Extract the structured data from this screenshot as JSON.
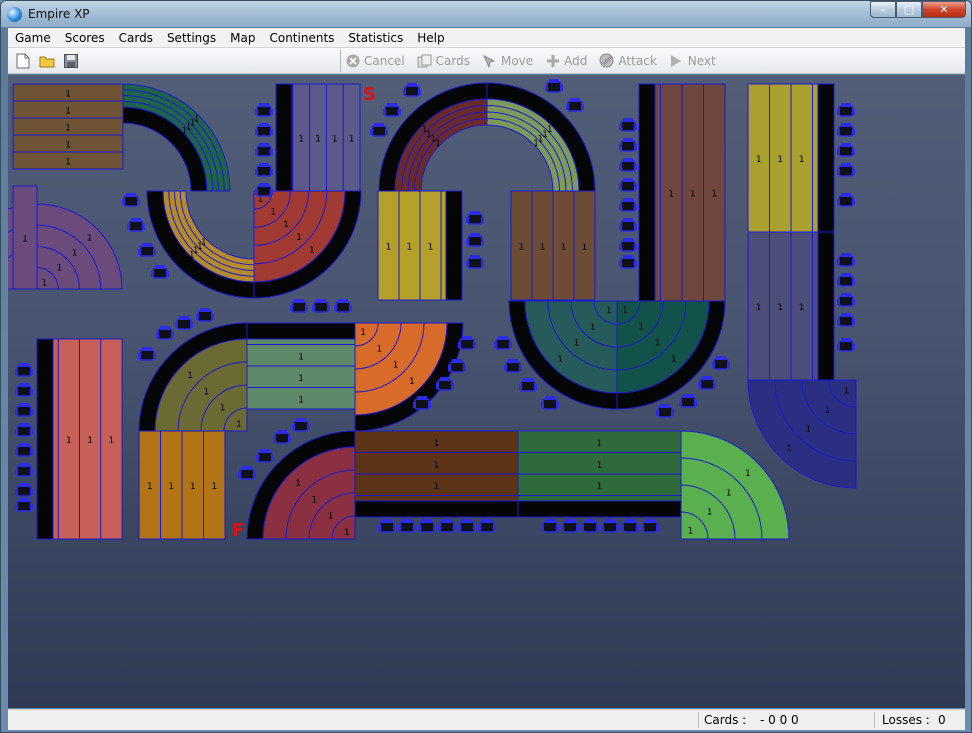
{
  "window": {
    "title": "Empire XP"
  },
  "menu": [
    "Game",
    "Scores",
    "Cards",
    "Settings",
    "Map",
    "Continents",
    "Statistics",
    "Help"
  ],
  "toolbar": {
    "file_icons": [
      "new-file-icon",
      "open-folder-icon",
      "save-icon"
    ],
    "actions": [
      {
        "label": "Cancel",
        "icon": "cancel-icon"
      },
      {
        "label": "Cards",
        "icon": "cards-icon"
      },
      {
        "label": "Move",
        "icon": "move-icon"
      },
      {
        "label": "Add",
        "icon": "add-icon"
      },
      {
        "label": "Attack",
        "icon": "attack-icon"
      },
      {
        "label": "Next",
        "icon": "next-icon"
      }
    ]
  },
  "map": {
    "start_marker": "S",
    "finish_marker": "F",
    "army_count": "1"
  },
  "status": {
    "cards_label": "Cards :",
    "cards_value": "- 0 0 0",
    "losses_label": "Losses :",
    "losses_value": "0"
  },
  "colors": {
    "track_outline": "#1a1ad0",
    "marker_red": "#e01010"
  }
}
